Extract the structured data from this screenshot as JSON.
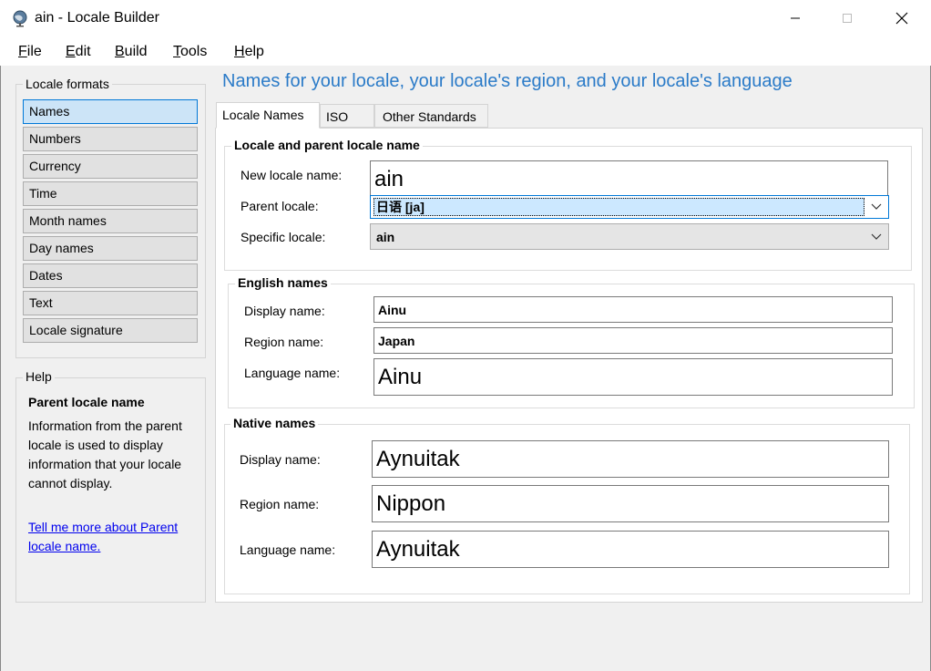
{
  "window": {
    "title": "ain - Locale Builder",
    "icon": "globe-icon",
    "controls": [
      "minimize-icon",
      "maximize-icon",
      "close-icon"
    ]
  },
  "menu": [
    {
      "key": "F",
      "rest": "ile"
    },
    {
      "key": "E",
      "rest": "dit"
    },
    {
      "key": "B",
      "rest": "uild"
    },
    {
      "key": "T",
      "rest": "ools"
    },
    {
      "key": "H",
      "rest": "elp"
    }
  ],
  "locale_formats": {
    "title": "Locale formats",
    "items": [
      "Names",
      "Numbers",
      "Currency",
      "Time",
      "Month names",
      "Day names",
      "Dates",
      "Text",
      "Locale signature"
    ],
    "selected": "Names"
  },
  "help": {
    "title": "Help",
    "heading": "Parent locale name",
    "body": "Information from the parent locale is used to display information that your locale cannot display.",
    "link": "Tell me more about Parent locale name."
  },
  "heading": "Names for your locale, your locale's region, and your locale's language",
  "tabs": [
    "Locale Names",
    "ISO",
    "Other Standards"
  ],
  "active_tab": "Locale Names",
  "locale_group": {
    "title": "Locale and parent locale name",
    "new_locale_label": "New locale name:",
    "new_locale_value": "ain",
    "parent_label": "Parent locale:",
    "parent_value": "日语 [ja]",
    "specific_label": "Specific locale:",
    "specific_value": "ain"
  },
  "english_group": {
    "title": "English names",
    "display_label": "Display name:",
    "display_value": "Ainu",
    "region_label": "Region name:",
    "region_value": "Japan",
    "language_label": "Language name:",
    "language_value": "Ainu"
  },
  "native_group": {
    "title": "Native names",
    "display_label": "Display name:",
    "display_value": "Aynuitak",
    "region_label": "Region name:",
    "region_value": "Nippon",
    "language_label": "Language name:",
    "language_value": "Aynuitak"
  },
  "colors": {
    "accent": "#2b7bc8",
    "selection": "#cce4f7",
    "link": "#0000ee"
  }
}
